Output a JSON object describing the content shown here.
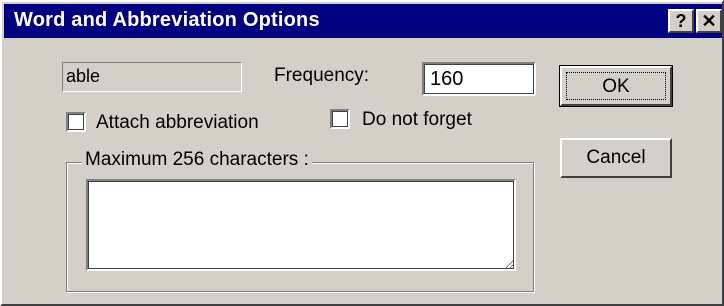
{
  "window": {
    "title": "Word and Abbreviation Options",
    "help_label": "?",
    "close_label": "✕"
  },
  "word": {
    "value": "able"
  },
  "frequency": {
    "label": "Frequency:",
    "value": "160"
  },
  "options": {
    "attach_abbreviation": {
      "label": "Attach abbreviation",
      "checked": false
    },
    "do_not_forget": {
      "label": "Do not forget",
      "checked": false
    }
  },
  "abbreviation_group": {
    "label": "Maximum 256 characters :",
    "value": ""
  },
  "buttons": {
    "ok_label": "OK",
    "cancel_label": "Cancel"
  }
}
